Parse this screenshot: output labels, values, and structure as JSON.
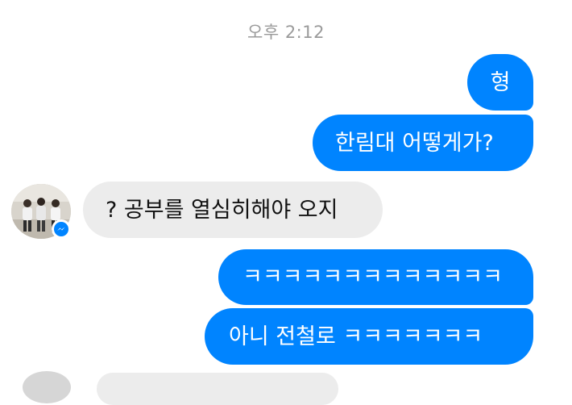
{
  "chat": {
    "timestamp": "오후 2:12",
    "messages": [
      {
        "sender": "me",
        "text": "형"
      },
      {
        "sender": "me",
        "text": "한림대 어떻게가?"
      },
      {
        "sender": "other",
        "text": "? 공부를 열심히해야 오지"
      },
      {
        "sender": "me",
        "text": "ㅋㅋㅋㅋㅋㅋㅋㅋㅋㅋㅋㅋㅋ"
      },
      {
        "sender": "me",
        "text": "아니 전철로 ㅋㅋㅋㅋㅋㅋㅋ"
      }
    ]
  },
  "colors": {
    "outgoing_bubble": "#0084ff",
    "incoming_bubble": "#ececec",
    "timestamp_text": "#9a9a9a"
  },
  "icons": {
    "sender_badge": "messenger-icon"
  }
}
